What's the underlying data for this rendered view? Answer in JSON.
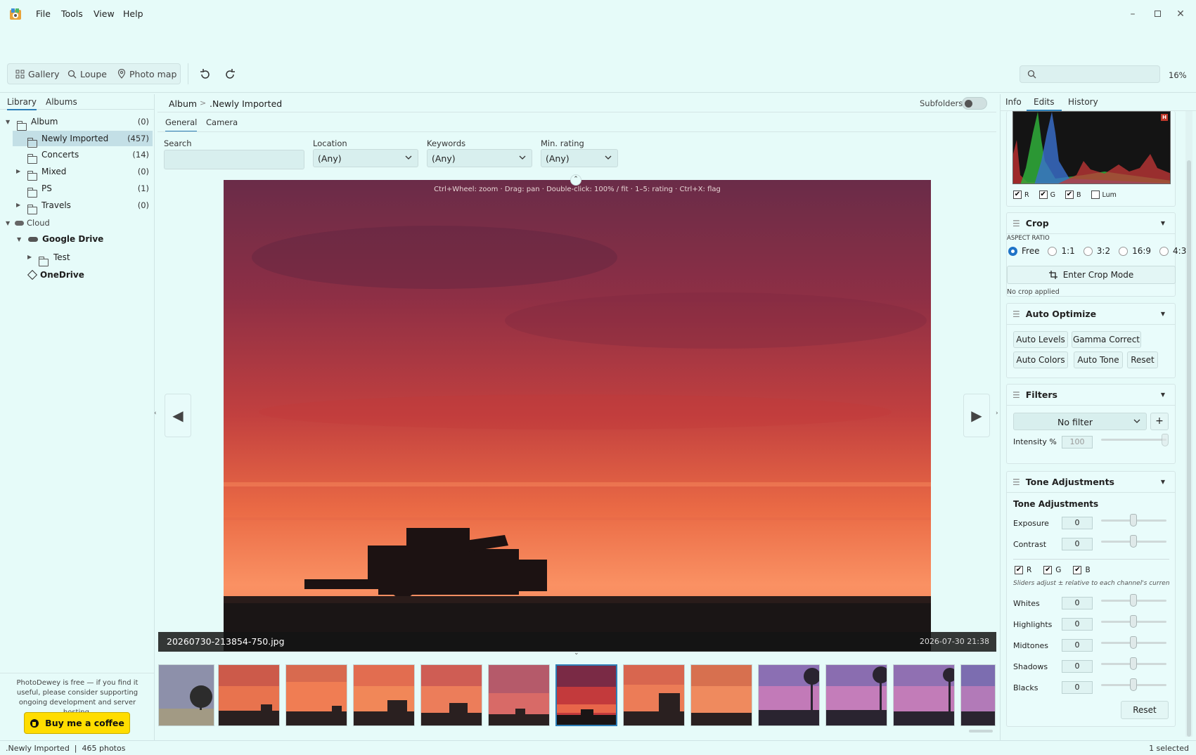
{
  "menu": {
    "file": "File",
    "tools": "Tools",
    "view": "View",
    "help": "Help"
  },
  "toolbar": {
    "gallery": "Gallery",
    "loupe": "Loupe",
    "photo_map": "Photo map",
    "zoom": "16%",
    "search_placeholder": ""
  },
  "left": {
    "tabs": [
      "Library",
      "Albums"
    ],
    "tree": [
      {
        "label": "Album",
        "count": "(0)"
      },
      {
        "label": "Newly Imported",
        "count": "(457)"
      },
      {
        "label": "Concerts",
        "count": "(14)"
      },
      {
        "label": "Mixed",
        "count": "(0)"
      },
      {
        "label": "PS",
        "count": "(1)"
      },
      {
        "label": "Travels",
        "count": "(0)"
      },
      {
        "label": "Cloud",
        "count": ""
      },
      {
        "label": "Google Drive",
        "count": ""
      },
      {
        "label": "Test",
        "count": ""
      },
      {
        "label": "OneDrive",
        "count": ""
      }
    ],
    "donate_text": "PhotoDewey is free — if you find it useful, please consider supporting ongoing development and server hosting.",
    "coffee_button": "Buy me a coffee"
  },
  "center": {
    "breadcrumb": [
      "Album",
      ">",
      ".Newly Imported"
    ],
    "subfolders": "Subfolders",
    "tabs": [
      "General",
      "Camera"
    ],
    "filters": {
      "search_label": "Search",
      "search_value": "",
      "location_label": "Location",
      "location_value": "(Any)",
      "keywords_label": "Keywords",
      "keywords_value": "(Any)",
      "rating_label": "Min. rating",
      "rating_value": "(Any)"
    },
    "hint": "Ctrl+Wheel: zoom  ·  Drag: pan  ·  Double-click: 100% / fit  ·  1–5: rating  ·  Ctrl+X: flag",
    "filename": "20260730-213854-750.jpg",
    "datetime": "2026-07-30 21:38",
    "prev": "◀",
    "next": "▶"
  },
  "right": {
    "tabs": [
      "Info",
      "Edits",
      "History"
    ],
    "histogram_flag": "H",
    "hist_channels": [
      "R",
      "G",
      "B",
      "Lum"
    ],
    "crop": {
      "title": "Crop",
      "aspect_label": "ASPECT RATIO",
      "ratios": [
        "Free",
        "1:1",
        "3:2",
        "16:9",
        "4:3"
      ],
      "enter": "Enter Crop Mode",
      "status": "No crop applied"
    },
    "auto": {
      "title": "Auto Optimize",
      "buttons": [
        "Auto Levels",
        "Gamma Correct",
        "Auto Colors",
        "Auto Tone",
        "Reset"
      ]
    },
    "filters": {
      "title": "Filters",
      "selected": "No filter",
      "add": "+",
      "intensity_label": "Intensity %",
      "intensity": "100"
    },
    "tone": {
      "title": "Tone Adjustments",
      "subtitle": "Tone Adjustments",
      "top": [
        {
          "label": "Exposure",
          "value": "0"
        },
        {
          "label": "Contrast",
          "value": "0"
        }
      ],
      "channels": [
        "R",
        "G",
        "B"
      ],
      "note": "Sliders adjust ± relative to each channel's current va",
      "bottom": [
        {
          "label": "Whites",
          "value": "0"
        },
        {
          "label": "Highlights",
          "value": "0"
        },
        {
          "label": "Midtones",
          "value": "0"
        },
        {
          "label": "Shadows",
          "value": "0"
        },
        {
          "label": "Blacks",
          "value": "0"
        }
      ],
      "reset": "Reset"
    }
  },
  "status": {
    "left": ".Newly Imported  |  465 photos",
    "right": "1 selected"
  },
  "colors": {
    "accent": "#2d7fb8",
    "coffee": "#ffdd00",
    "background": "#e6fbf9"
  }
}
